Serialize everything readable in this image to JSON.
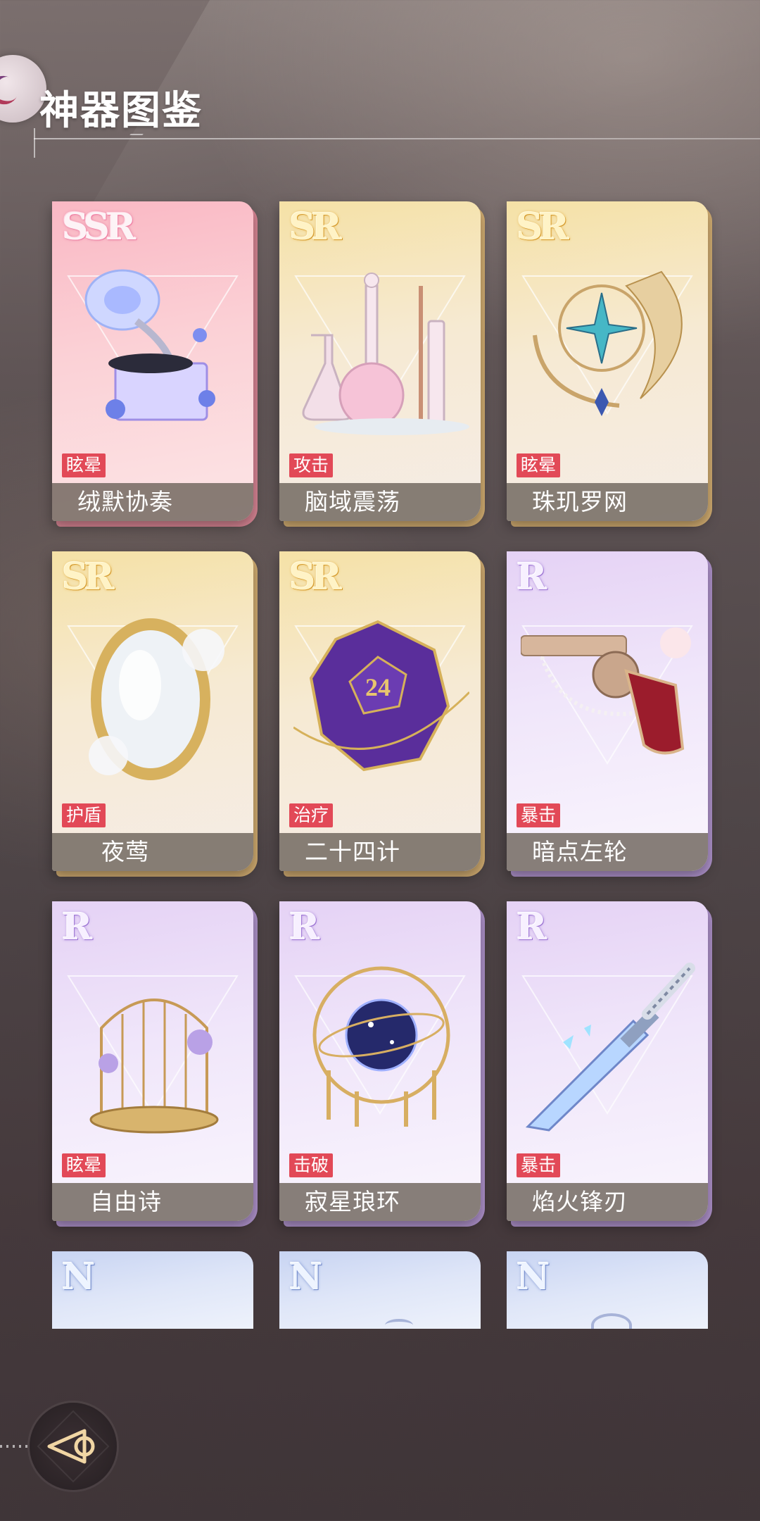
{
  "header": {
    "title": "神器图鉴",
    "logo_icon": "app-logo-icon"
  },
  "cards": [
    {
      "rarity": "SSR",
      "tag": "眩晕",
      "name": "绒默协奏",
      "icon": "gramophone-icon"
    },
    {
      "rarity": "SR",
      "tag": "攻击",
      "name": "脑域震荡",
      "icon": "lab-flask-icon"
    },
    {
      "rarity": "SR",
      "tag": "眩晕",
      "name": "珠玑罗网",
      "icon": "dreamcatcher-icon"
    },
    {
      "rarity": "SR",
      "tag": "护盾",
      "name": "夜莺",
      "icon": "mirror-icon"
    },
    {
      "rarity": "SR",
      "tag": "治疗",
      "name": "二十四计",
      "icon": "d24-dice-icon",
      "dice_face": "24"
    },
    {
      "rarity": "R",
      "tag": "暴击",
      "name": "暗点左轮",
      "icon": "revolver-icon"
    },
    {
      "rarity": "R",
      "tag": "眩晕",
      "name": "自由诗",
      "icon": "birdcage-icon"
    },
    {
      "rarity": "R",
      "tag": "击破",
      "name": "寂星琅环",
      "icon": "star-orb-icon"
    },
    {
      "rarity": "R",
      "tag": "暴击",
      "name": "焰火锋刃",
      "icon": "dagger-icon"
    },
    {
      "rarity": "N",
      "icon": "unknown-icon"
    },
    {
      "rarity": "N",
      "icon": "unknown-icon"
    },
    {
      "rarity": "N",
      "icon": "unknown-icon"
    }
  ],
  "footer": {
    "back_icon": "back-arrow-icon"
  },
  "colors": {
    "tag_bg": "#e24957",
    "ssr": "#fab8c4",
    "sr": "#f5e1a6",
    "r": "#e5d2f5",
    "n": "#c8d4f2"
  }
}
